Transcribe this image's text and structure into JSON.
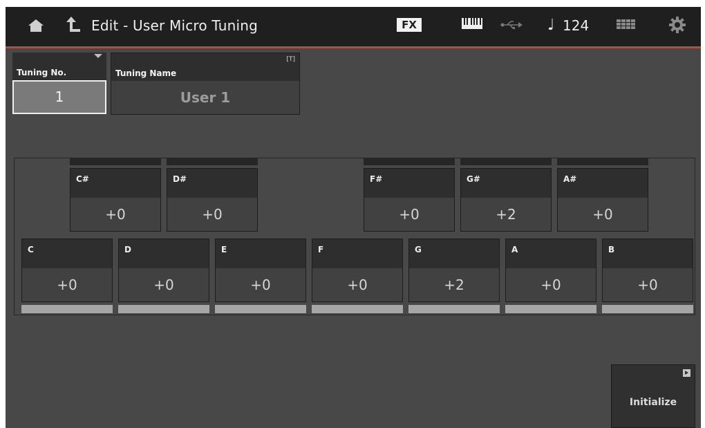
{
  "header": {
    "title": "Edit - User Micro Tuning",
    "fx_label": "FX",
    "tempo_note": "♩",
    "tempo": "124"
  },
  "tuning_number": {
    "label": "Tuning No.",
    "value": "1"
  },
  "tuning_name": {
    "label": "Tuning Name",
    "text_icon": "[T]",
    "value": "User 1"
  },
  "black_keys": [
    {
      "name": "C#",
      "value": "+0"
    },
    {
      "name": "D#",
      "value": "+0"
    },
    {
      "name": "F#",
      "value": "+0"
    },
    {
      "name": "G#",
      "value": "+2"
    },
    {
      "name": "A#",
      "value": "+0"
    }
  ],
  "white_keys": [
    {
      "name": "C",
      "value": "+0"
    },
    {
      "name": "D",
      "value": "+0"
    },
    {
      "name": "E",
      "value": "+0"
    },
    {
      "name": "F",
      "value": "+0"
    },
    {
      "name": "G",
      "value": "+2"
    },
    {
      "name": "A",
      "value": "+0"
    },
    {
      "name": "B",
      "value": "+0"
    }
  ],
  "initialize": {
    "label": "Initialize"
  },
  "colors": {
    "accent": "#d0442c",
    "background": "#484848",
    "topbar": "#1f1f1f"
  }
}
